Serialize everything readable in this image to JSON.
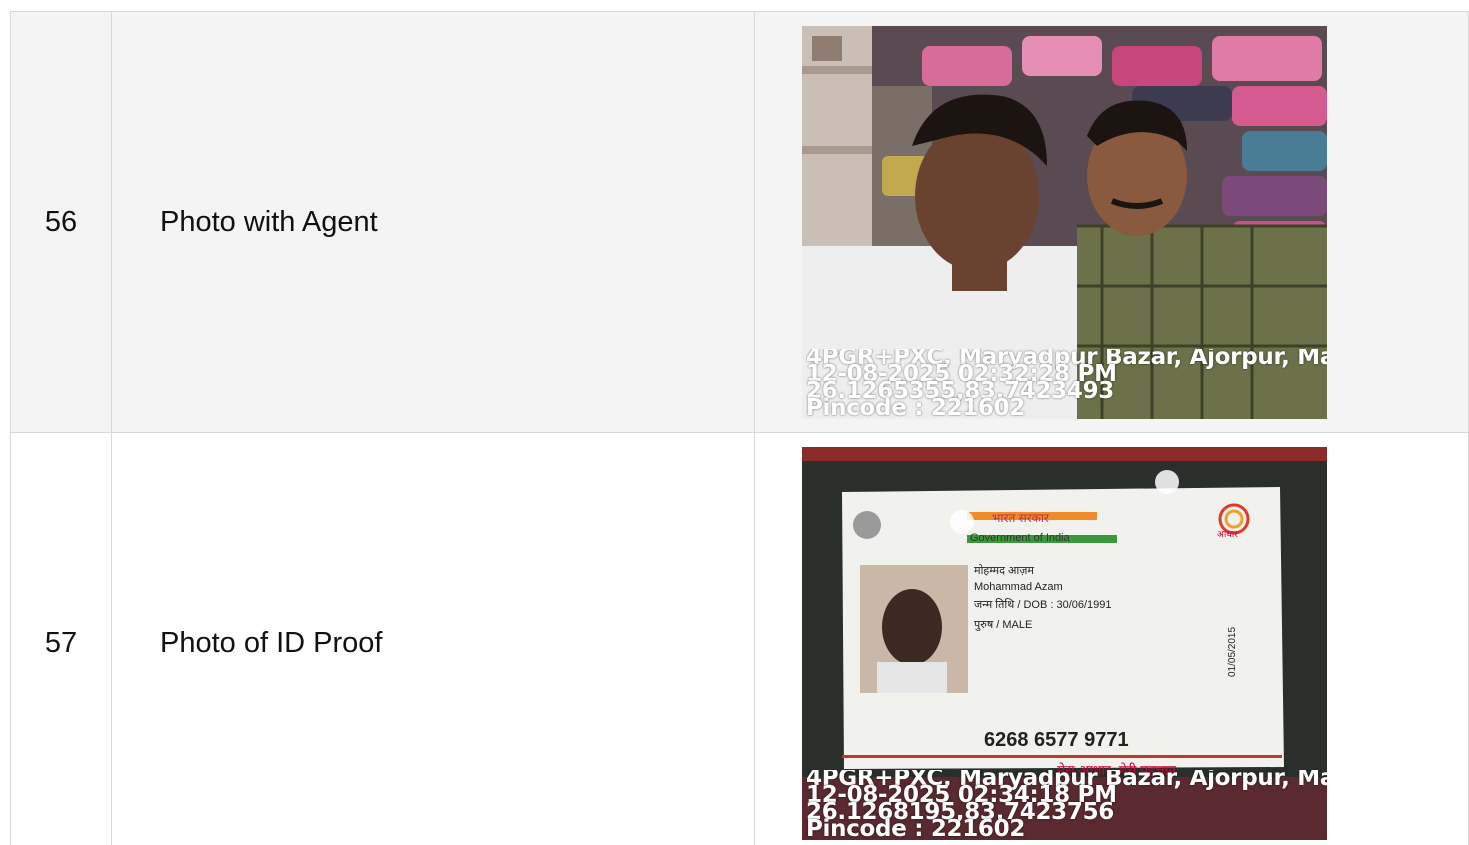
{
  "rows": [
    {
      "number": "56",
      "label": "Photo with Agent",
      "stamp": {
        "address": "4PGR+PXC, Maryadpur Bazar, Ajorpur, Ma",
        "datetime": "12-08-2025 02:32:28 PM",
        "coords": "26.1265355,83.7423493",
        "pincode": "Pincode : 221602"
      }
    },
    {
      "number": "57",
      "label": "Photo of ID Proof",
      "card": {
        "hindi_gov": "भारत सरकार",
        "gov": "Government of India",
        "aadhaar_logo": "आधार",
        "name_hindi": "मोहम्मद आज़म",
        "name": "Mohammad Azam",
        "dob": "जन्म तिथि / DOB : 30/06/1991",
        "gender": "पुरुष / MALE",
        "issue_date": "01/05/2015",
        "number": "6268 6577 9771",
        "tagline": "मेरा आधार, मेरी पहचान"
      },
      "stamp": {
        "address": "4PGR+PXC, Maryadpur Bazar, Ajorpur, Ma",
        "datetime": "12-08-2025 02:34:18 PM",
        "coords": "26.1268195,83.7423756",
        "pincode": "Pincode : 221602"
      }
    }
  ]
}
